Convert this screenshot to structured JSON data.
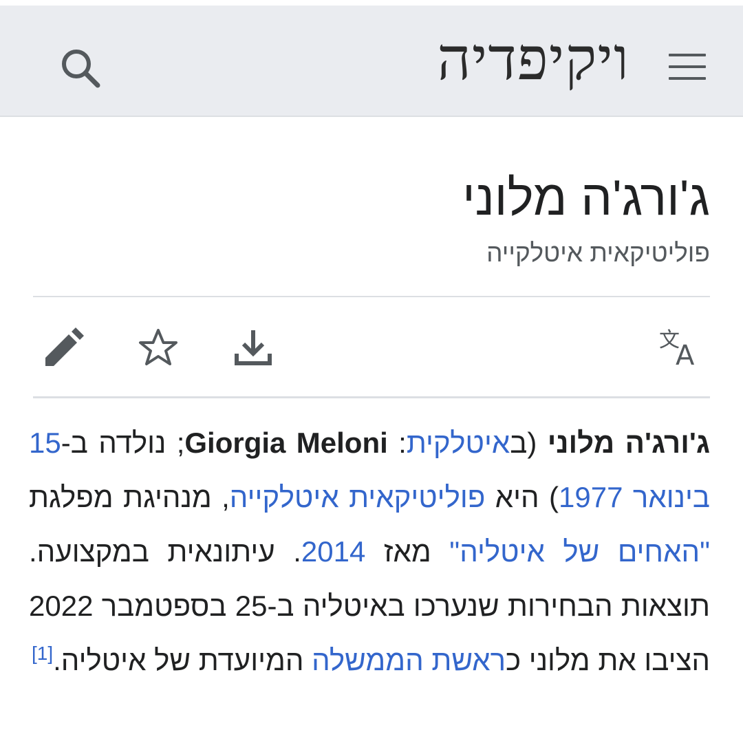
{
  "header": {
    "logo_text": "ויקיפדיה",
    "menu_icon": "hamburger-menu-icon",
    "search_icon": "search-icon"
  },
  "page": {
    "title": "ג'ורג'ה מלוני",
    "subtitle": "פוליטיקאית איטלקייה"
  },
  "toolbar": {
    "language_icon": "translate-icon",
    "download_icon": "download-icon",
    "watch_icon": "star-icon",
    "edit_icon": "pencil-icon"
  },
  "article": {
    "bold_name": "ג'ורג'ה מלוני",
    "paren_open": " (ב",
    "link_italian": "איטלקית",
    "colon": ": ",
    "latin_name": "Giorgia Meloni",
    "born_text": "; נולדה ב-",
    "link_date": "15 בינואר",
    "space1": " ",
    "link_year": "1977",
    "text_she_is": ") היא ",
    "link_politician": "פוליטיקאית איטלקייה",
    "text_leader": ", מנהיגת מפלגת ",
    "link_party": "\"האחים של איטליה\"",
    "text_since": " מאז ",
    "link_2014": "2014",
    "text_journalist": ". עיתונאית במקצועה. תוצאות הבחירות שנערכו באיטליה ב-25 בספטמבר 2022 הציבו את מלוני כ",
    "link_pm": "ראשת הממשלה",
    "text_designate": " המיועדת של איטליה.",
    "ref": "[1]"
  },
  "colors": {
    "link": "#3366cc",
    "header_bg": "#eaecf0",
    "text": "#202122",
    "muted": "#54595d"
  }
}
